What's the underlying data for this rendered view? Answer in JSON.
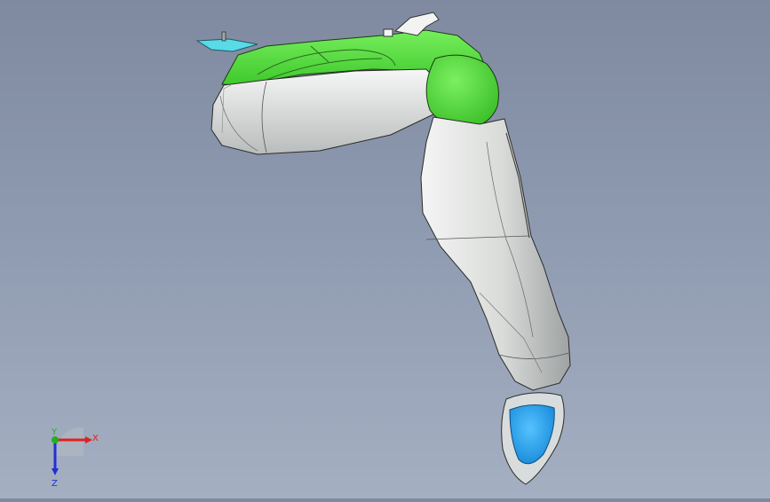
{
  "viewport": {
    "background_top": "#7f8aa0",
    "background_bottom": "#a5afc2",
    "model": {
      "parts": [
        {
          "name": "upper-housing",
          "color": "#5fe34a"
        },
        {
          "name": "shoulder-joint",
          "color": "#4fd83c"
        },
        {
          "name": "upper-arm-shell",
          "color": "#e6e8e6"
        },
        {
          "name": "forearm-shell",
          "color": "#e3e5e3"
        },
        {
          "name": "fingertip",
          "color": "#2aa4f0"
        },
        {
          "name": "connector-bracket",
          "color": "#5ad9e6"
        }
      ]
    }
  },
  "triad": {
    "x_label": "X",
    "y_label": "Y",
    "z_label": "Z",
    "x_color": "#e02020",
    "y_color": "#20b020",
    "z_color": "#2030d0"
  }
}
